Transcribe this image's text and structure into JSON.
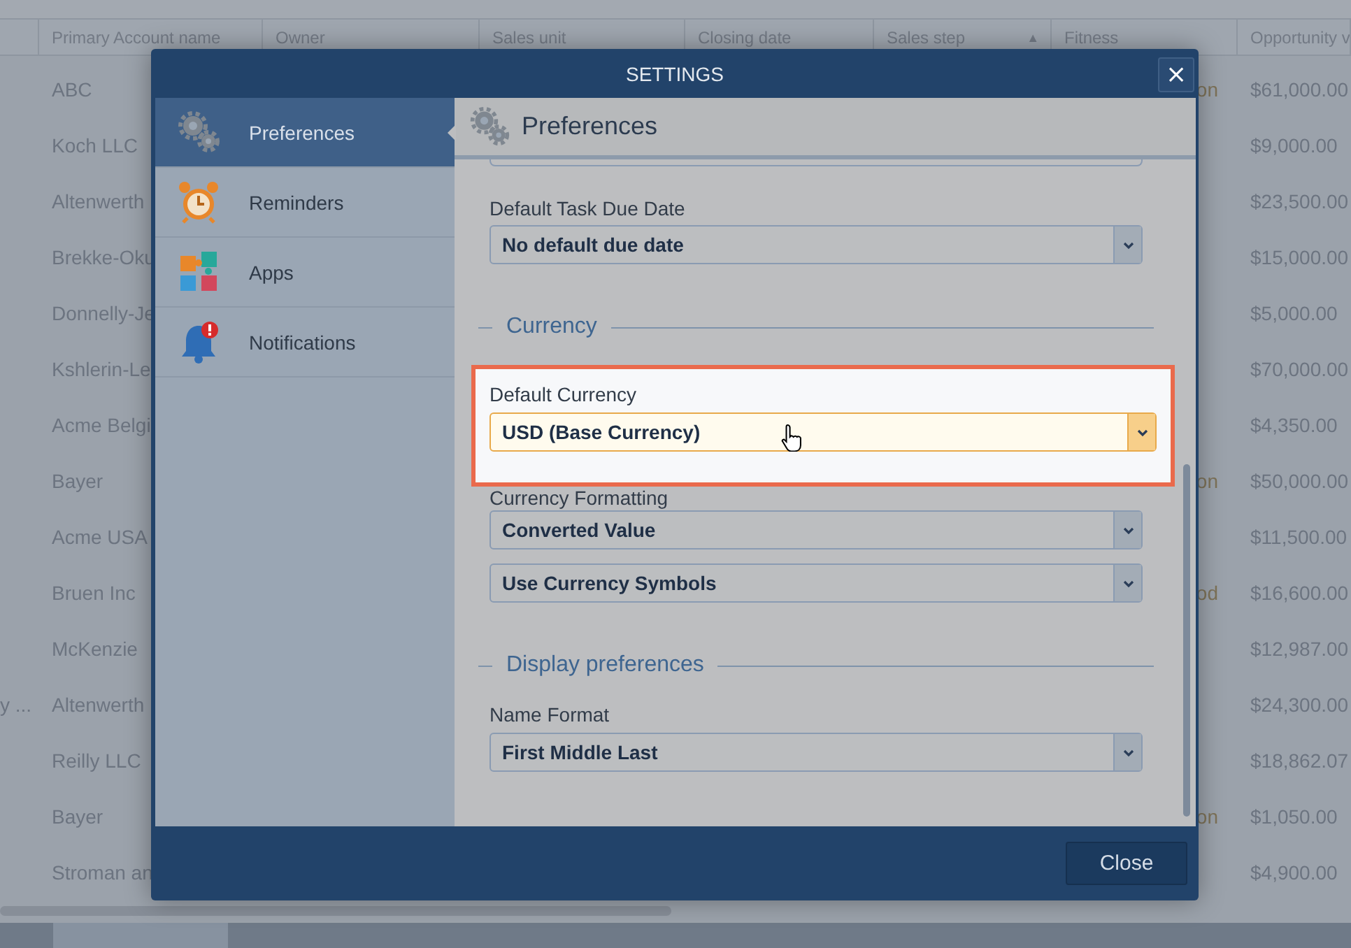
{
  "background_table": {
    "columns": [
      {
        "label": "Primary Account name"
      },
      {
        "label": "Owner"
      },
      {
        "label": "Sales unit"
      },
      {
        "label": "Closing date"
      },
      {
        "label": "Sales step",
        "sort_mark": "▲"
      },
      {
        "label": "Fitness"
      },
      {
        "label": "Opportunity v"
      }
    ],
    "rows": [
      {
        "account": "ABC",
        "fitness": "on",
        "amount": "$61,000.00"
      },
      {
        "account": "Koch LLC",
        "amount": "$9,000.00"
      },
      {
        "account": "Altenwerth",
        "amount": "$23,500.00"
      },
      {
        "account": "Brekke-Oku",
        "amount": "$15,000.00"
      },
      {
        "account": "Donnelly-Je",
        "amount": "$5,000.00"
      },
      {
        "account": "Kshlerin-Le",
        "amount": "$70,000.00"
      },
      {
        "account": "Acme Belgi",
        "amount": "$4,350.00"
      },
      {
        "account": "Bayer",
        "fitness": "on",
        "amount": "$50,000.00"
      },
      {
        "account": "Acme USA",
        "amount": "$11,500.00"
      },
      {
        "account": "Bruen Inc",
        "fitness": "od",
        "amount": "$16,600.00"
      },
      {
        "account": "McKenzie",
        "amount": "$12,987.00"
      },
      {
        "lead": "y ...",
        "account": "Altenwerth",
        "amount": "$24,300.00"
      },
      {
        "account": "Reilly LLC",
        "amount": "$18,862.07"
      },
      {
        "account": "Bayer",
        "fitness": "on",
        "amount": "$1,050.00"
      },
      {
        "account": "Stroman an",
        "amount": "$4,900.00"
      }
    ]
  },
  "dialog": {
    "title": "SETTINGS",
    "close_glyph": "×",
    "sidebar": {
      "items": [
        {
          "label": "Preferences",
          "selected": true
        },
        {
          "label": "Reminders",
          "selected": false
        },
        {
          "label": "Apps",
          "selected": false
        },
        {
          "label": "Notifications",
          "selected": false
        }
      ]
    },
    "panel": {
      "title": "Preferences",
      "items": [
        {
          "kind": "cut_select"
        },
        {
          "kind": "field",
          "label": "Default Task Due Date",
          "value": "No default due date",
          "highlighted": false
        },
        {
          "kind": "section",
          "label": "Currency"
        },
        {
          "kind": "field",
          "label": "Default Currency",
          "value": "USD (Base Currency)",
          "highlighted": true
        },
        {
          "kind": "field",
          "label": "Currency Formatting",
          "value": "Converted Value",
          "highlighted": false
        },
        {
          "kind": "select",
          "value": "Use Currency Symbols"
        },
        {
          "kind": "section",
          "label": "Display preferences"
        },
        {
          "kind": "field",
          "label": "Name Format",
          "value": "First Middle Last",
          "highlighted": false
        }
      ]
    },
    "footer": {
      "buttons": [
        "Close"
      ]
    }
  }
}
